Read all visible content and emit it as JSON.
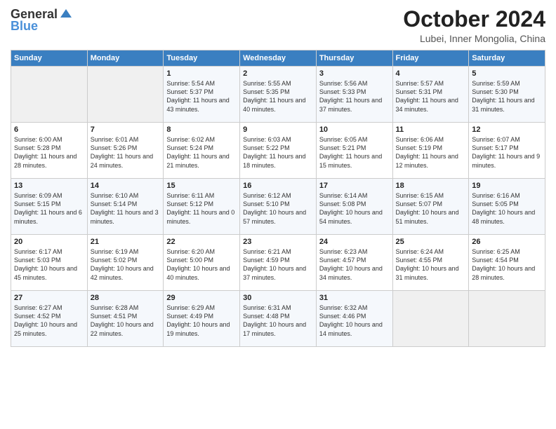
{
  "header": {
    "logo_general": "General",
    "logo_blue": "Blue",
    "month_title": "October 2024",
    "subtitle": "Lubei, Inner Mongolia, China"
  },
  "days_of_week": [
    "Sunday",
    "Monday",
    "Tuesday",
    "Wednesday",
    "Thursday",
    "Friday",
    "Saturday"
  ],
  "weeks": [
    [
      {
        "num": "",
        "sunrise": "",
        "sunset": "",
        "daylight": "",
        "empty": true
      },
      {
        "num": "",
        "sunrise": "",
        "sunset": "",
        "daylight": "",
        "empty": true
      },
      {
        "num": "1",
        "sunrise": "Sunrise: 5:54 AM",
        "sunset": "Sunset: 5:37 PM",
        "daylight": "Daylight: 11 hours and 43 minutes."
      },
      {
        "num": "2",
        "sunrise": "Sunrise: 5:55 AM",
        "sunset": "Sunset: 5:35 PM",
        "daylight": "Daylight: 11 hours and 40 minutes."
      },
      {
        "num": "3",
        "sunrise": "Sunrise: 5:56 AM",
        "sunset": "Sunset: 5:33 PM",
        "daylight": "Daylight: 11 hours and 37 minutes."
      },
      {
        "num": "4",
        "sunrise": "Sunrise: 5:57 AM",
        "sunset": "Sunset: 5:31 PM",
        "daylight": "Daylight: 11 hours and 34 minutes."
      },
      {
        "num": "5",
        "sunrise": "Sunrise: 5:59 AM",
        "sunset": "Sunset: 5:30 PM",
        "daylight": "Daylight: 11 hours and 31 minutes."
      }
    ],
    [
      {
        "num": "6",
        "sunrise": "Sunrise: 6:00 AM",
        "sunset": "Sunset: 5:28 PM",
        "daylight": "Daylight: 11 hours and 28 minutes."
      },
      {
        "num": "7",
        "sunrise": "Sunrise: 6:01 AM",
        "sunset": "Sunset: 5:26 PM",
        "daylight": "Daylight: 11 hours and 24 minutes."
      },
      {
        "num": "8",
        "sunrise": "Sunrise: 6:02 AM",
        "sunset": "Sunset: 5:24 PM",
        "daylight": "Daylight: 11 hours and 21 minutes."
      },
      {
        "num": "9",
        "sunrise": "Sunrise: 6:03 AM",
        "sunset": "Sunset: 5:22 PM",
        "daylight": "Daylight: 11 hours and 18 minutes."
      },
      {
        "num": "10",
        "sunrise": "Sunrise: 6:05 AM",
        "sunset": "Sunset: 5:21 PM",
        "daylight": "Daylight: 11 hours and 15 minutes."
      },
      {
        "num": "11",
        "sunrise": "Sunrise: 6:06 AM",
        "sunset": "Sunset: 5:19 PM",
        "daylight": "Daylight: 11 hours and 12 minutes."
      },
      {
        "num": "12",
        "sunrise": "Sunrise: 6:07 AM",
        "sunset": "Sunset: 5:17 PM",
        "daylight": "Daylight: 11 hours and 9 minutes."
      }
    ],
    [
      {
        "num": "13",
        "sunrise": "Sunrise: 6:09 AM",
        "sunset": "Sunset: 5:15 PM",
        "daylight": "Daylight: 11 hours and 6 minutes."
      },
      {
        "num": "14",
        "sunrise": "Sunrise: 6:10 AM",
        "sunset": "Sunset: 5:14 PM",
        "daylight": "Daylight: 11 hours and 3 minutes."
      },
      {
        "num": "15",
        "sunrise": "Sunrise: 6:11 AM",
        "sunset": "Sunset: 5:12 PM",
        "daylight": "Daylight: 11 hours and 0 minutes."
      },
      {
        "num": "16",
        "sunrise": "Sunrise: 6:12 AM",
        "sunset": "Sunset: 5:10 PM",
        "daylight": "Daylight: 10 hours and 57 minutes."
      },
      {
        "num": "17",
        "sunrise": "Sunrise: 6:14 AM",
        "sunset": "Sunset: 5:08 PM",
        "daylight": "Daylight: 10 hours and 54 minutes."
      },
      {
        "num": "18",
        "sunrise": "Sunrise: 6:15 AM",
        "sunset": "Sunset: 5:07 PM",
        "daylight": "Daylight: 10 hours and 51 minutes."
      },
      {
        "num": "19",
        "sunrise": "Sunrise: 6:16 AM",
        "sunset": "Sunset: 5:05 PM",
        "daylight": "Daylight: 10 hours and 48 minutes."
      }
    ],
    [
      {
        "num": "20",
        "sunrise": "Sunrise: 6:17 AM",
        "sunset": "Sunset: 5:03 PM",
        "daylight": "Daylight: 10 hours and 45 minutes."
      },
      {
        "num": "21",
        "sunrise": "Sunrise: 6:19 AM",
        "sunset": "Sunset: 5:02 PM",
        "daylight": "Daylight: 10 hours and 42 minutes."
      },
      {
        "num": "22",
        "sunrise": "Sunrise: 6:20 AM",
        "sunset": "Sunset: 5:00 PM",
        "daylight": "Daylight: 10 hours and 40 minutes."
      },
      {
        "num": "23",
        "sunrise": "Sunrise: 6:21 AM",
        "sunset": "Sunset: 4:59 PM",
        "daylight": "Daylight: 10 hours and 37 minutes."
      },
      {
        "num": "24",
        "sunrise": "Sunrise: 6:23 AM",
        "sunset": "Sunset: 4:57 PM",
        "daylight": "Daylight: 10 hours and 34 minutes."
      },
      {
        "num": "25",
        "sunrise": "Sunrise: 6:24 AM",
        "sunset": "Sunset: 4:55 PM",
        "daylight": "Daylight: 10 hours and 31 minutes."
      },
      {
        "num": "26",
        "sunrise": "Sunrise: 6:25 AM",
        "sunset": "Sunset: 4:54 PM",
        "daylight": "Daylight: 10 hours and 28 minutes."
      }
    ],
    [
      {
        "num": "27",
        "sunrise": "Sunrise: 6:27 AM",
        "sunset": "Sunset: 4:52 PM",
        "daylight": "Daylight: 10 hours and 25 minutes."
      },
      {
        "num": "28",
        "sunrise": "Sunrise: 6:28 AM",
        "sunset": "Sunset: 4:51 PM",
        "daylight": "Daylight: 10 hours and 22 minutes."
      },
      {
        "num": "29",
        "sunrise": "Sunrise: 6:29 AM",
        "sunset": "Sunset: 4:49 PM",
        "daylight": "Daylight: 10 hours and 19 minutes."
      },
      {
        "num": "30",
        "sunrise": "Sunrise: 6:31 AM",
        "sunset": "Sunset: 4:48 PM",
        "daylight": "Daylight: 10 hours and 17 minutes."
      },
      {
        "num": "31",
        "sunrise": "Sunrise: 6:32 AM",
        "sunset": "Sunset: 4:46 PM",
        "daylight": "Daylight: 10 hours and 14 minutes."
      },
      {
        "num": "",
        "sunrise": "",
        "sunset": "",
        "daylight": "",
        "empty": true
      },
      {
        "num": "",
        "sunrise": "",
        "sunset": "",
        "daylight": "",
        "empty": true
      }
    ]
  ]
}
